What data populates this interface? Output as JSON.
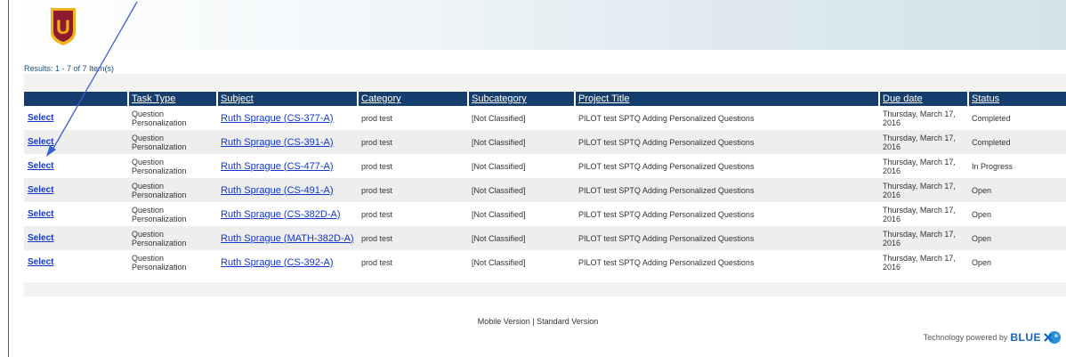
{
  "results_text": "Results: 1 - 7 of 7 Item(s)",
  "columns": [
    "",
    "Task Type",
    "Subject",
    "Category",
    "Subcategory",
    "Project Title",
    "Due date",
    "Status"
  ],
  "rows": [
    {
      "select": "Select",
      "task_type": "Question Personalization",
      "subject": "Ruth Sprague (CS-377-A)",
      "category": "prod test",
      "subcategory": "[Not Classified]",
      "project_title": "PILOT test SPTQ Adding Personalized Questions",
      "due_date": "Thursday, March 17, 2016",
      "status": "Completed"
    },
    {
      "select": "Select",
      "task_type": "Question Personalization",
      "subject": "Ruth Sprague (CS-391-A)",
      "category": "prod test",
      "subcategory": "[Not Classified]",
      "project_title": "PILOT test SPTQ Adding Personalized Questions",
      "due_date": "Thursday, March 17, 2016",
      "status": "Completed"
    },
    {
      "select": "Select",
      "task_type": "Question Personalization",
      "subject": "Ruth Sprague (CS-477-A)",
      "category": "prod test",
      "subcategory": "[Not Classified]",
      "project_title": "PILOT test SPTQ Adding Personalized Questions",
      "due_date": "Thursday, March 17, 2016",
      "status": "In Progress"
    },
    {
      "select": "Select",
      "task_type": "Question Personalization",
      "subject": "Ruth Sprague (CS-491-A)",
      "category": "prod test",
      "subcategory": "[Not Classified]",
      "project_title": "PILOT test SPTQ Adding Personalized Questions",
      "due_date": "Thursday, March 17, 2016",
      "status": "Open"
    },
    {
      "select": "Select",
      "task_type": "Question Personalization",
      "subject": "Ruth Sprague (CS-382D-A)",
      "category": "prod test",
      "subcategory": "[Not Classified]",
      "project_title": "PILOT test SPTQ Adding Personalized Questions",
      "due_date": "Thursday, March 17, 2016",
      "status": "Open"
    },
    {
      "select": "Select",
      "task_type": "Question Personalization",
      "subject": "Ruth Sprague (MATH-382D-A)",
      "category": "prod test",
      "subcategory": "[Not Classified]",
      "project_title": "PILOT test SPTQ Adding Personalized Questions",
      "due_date": "Thursday, March 17, 2016",
      "status": "Open"
    },
    {
      "select": "Select",
      "task_type": "Question Personalization",
      "subject": "Ruth Sprague (CS-392-A)",
      "category": "prod test",
      "subcategory": "[Not Classified]",
      "project_title": "PILOT test SPTQ Adding Personalized Questions",
      "due_date": "Thursday, March 17, 2016",
      "status": "Open"
    }
  ],
  "footer": {
    "mobile": "Mobile Version",
    "separator": " | ",
    "standard": "Standard Version"
  },
  "powered": {
    "text": "Technology powered by",
    "brand": "BLUE"
  },
  "logo": {
    "letter": "U"
  },
  "colors": {
    "header_row": "#153e6e",
    "link": "#1538c8",
    "arrow": "#3a5ecf",
    "logo_shield": "#7a1528",
    "logo_gold": "#f2b01e"
  }
}
